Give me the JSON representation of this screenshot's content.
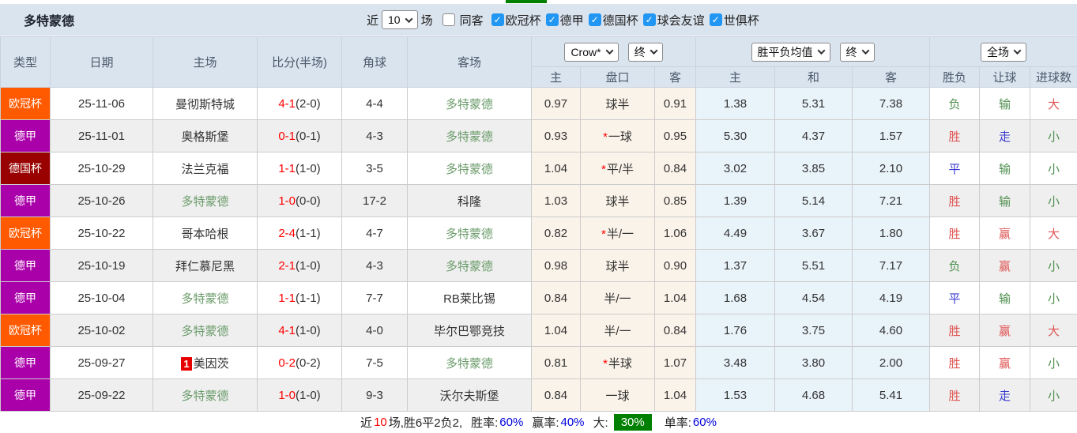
{
  "header": {
    "title": "多特蒙德"
  },
  "filters": {
    "near_label": "近",
    "recent_value": "10",
    "matches_label": "场",
    "same_away_label": "同客",
    "same_away_checked": false,
    "leagues": [
      {
        "label": "欧冠杯",
        "checked": true
      },
      {
        "label": "德甲",
        "checked": true
      },
      {
        "label": "德国杯",
        "checked": true
      },
      {
        "label": "球会友谊",
        "checked": true
      },
      {
        "label": "世俱杯",
        "checked": true
      }
    ]
  },
  "selects": {
    "odds_company": "Crow*",
    "odds_time": "终",
    "avg_type": "胜平负均值",
    "avg_time": "终",
    "period": "全场"
  },
  "table": {
    "headers": {
      "type": "类型",
      "date": "日期",
      "home": "主场",
      "score": "比分(半场)",
      "corners": "角球",
      "away": "客场",
      "odds_home": "主",
      "handicap": "盘口",
      "odds_away": "客",
      "avg_home": "主",
      "avg_draw": "和",
      "avg_away": "客",
      "result_wdl": "胜负",
      "result_handicap": "让球",
      "result_goals": "进球数"
    },
    "league_colors": {
      "欧冠杯": "#ff5a00",
      "德甲": "#aa00aa",
      "德国杯": "#990000"
    },
    "rows": [
      {
        "league": "欧冠杯",
        "date": "25-11-06",
        "home": "曼彻斯特城",
        "home_is_team": false,
        "home_rank": "",
        "score": "4-1",
        "half": "(2-0)",
        "corners": "4-4",
        "away": "多特蒙德",
        "away_is_team": true,
        "odds_home": "0.97",
        "handicap": "球半",
        "handicap_star": false,
        "odds_away": "0.91",
        "avg_home": "1.38",
        "avg_draw": "5.31",
        "avg_away": "7.38",
        "res_wdl": "负",
        "res_wdl_c": "green",
        "res_let": "输",
        "res_let_c": "green",
        "res_goal": "大",
        "res_goal_c": "red"
      },
      {
        "league": "德甲",
        "date": "25-11-01",
        "home": "奥格斯堡",
        "home_is_team": false,
        "home_rank": "",
        "score": "0-1",
        "half": "(0-1)",
        "corners": "4-3",
        "away": "多特蒙德",
        "away_is_team": true,
        "odds_home": "0.93",
        "handicap": "一球",
        "handicap_star": true,
        "odds_away": "0.95",
        "avg_home": "5.30",
        "avg_draw": "4.37",
        "avg_away": "1.57",
        "res_wdl": "胜",
        "res_wdl_c": "red",
        "res_let": "走",
        "res_let_c": "blue",
        "res_goal": "小",
        "res_goal_c": "green"
      },
      {
        "league": "德国杯",
        "date": "25-10-29",
        "home": "法兰克福",
        "home_is_team": false,
        "home_rank": "",
        "score": "1-1",
        "half": "(1-0)",
        "corners": "3-5",
        "away": "多特蒙德",
        "away_is_team": true,
        "odds_home": "1.04",
        "handicap": "平/半",
        "handicap_star": true,
        "odds_away": "0.84",
        "avg_home": "3.02",
        "avg_draw": "3.85",
        "avg_away": "2.10",
        "res_wdl": "平",
        "res_wdl_c": "blue",
        "res_let": "输",
        "res_let_c": "green",
        "res_goal": "小",
        "res_goal_c": "green"
      },
      {
        "league": "德甲",
        "date": "25-10-26",
        "home": "多特蒙德",
        "home_is_team": true,
        "home_rank": "",
        "score": "1-0",
        "half": "(0-0)",
        "corners": "17-2",
        "away": "科隆",
        "away_is_team": false,
        "odds_home": "1.03",
        "handicap": "球半",
        "handicap_star": false,
        "odds_away": "0.85",
        "avg_home": "1.39",
        "avg_draw": "5.14",
        "avg_away": "7.21",
        "res_wdl": "胜",
        "res_wdl_c": "red",
        "res_let": "输",
        "res_let_c": "green",
        "res_goal": "小",
        "res_goal_c": "green"
      },
      {
        "league": "欧冠杯",
        "date": "25-10-22",
        "home": "哥本哈根",
        "home_is_team": false,
        "home_rank": "",
        "score": "2-4",
        "half": "(1-1)",
        "corners": "4-7",
        "away": "多特蒙德",
        "away_is_team": true,
        "odds_home": "0.82",
        "handicap": "半/一",
        "handicap_star": true,
        "odds_away": "1.06",
        "avg_home": "4.49",
        "avg_draw": "3.67",
        "avg_away": "1.80",
        "res_wdl": "胜",
        "res_wdl_c": "red",
        "res_let": "赢",
        "res_let_c": "red",
        "res_goal": "大",
        "res_goal_c": "red"
      },
      {
        "league": "德甲",
        "date": "25-10-19",
        "home": "拜仁慕尼黑",
        "home_is_team": false,
        "home_rank": "",
        "score": "2-1",
        "half": "(1-0)",
        "corners": "4-3",
        "away": "多特蒙德",
        "away_is_team": true,
        "odds_home": "0.98",
        "handicap": "球半",
        "handicap_star": false,
        "odds_away": "0.90",
        "avg_home": "1.37",
        "avg_draw": "5.51",
        "avg_away": "7.17",
        "res_wdl": "负",
        "res_wdl_c": "green",
        "res_let": "赢",
        "res_let_c": "red",
        "res_goal": "小",
        "res_goal_c": "green"
      },
      {
        "league": "德甲",
        "date": "25-10-04",
        "home": "多特蒙德",
        "home_is_team": true,
        "home_rank": "",
        "score": "1-1",
        "half": "(1-1)",
        "corners": "7-7",
        "away": "RB莱比锡",
        "away_is_team": false,
        "odds_home": "0.84",
        "handicap": "半/一",
        "handicap_star": false,
        "odds_away": "1.04",
        "avg_home": "1.68",
        "avg_draw": "4.54",
        "avg_away": "4.19",
        "res_wdl": "平",
        "res_wdl_c": "blue",
        "res_let": "输",
        "res_let_c": "green",
        "res_goal": "小",
        "res_goal_c": "green"
      },
      {
        "league": "欧冠杯",
        "date": "25-10-02",
        "home": "多特蒙德",
        "home_is_team": true,
        "home_rank": "",
        "score": "4-1",
        "half": "(1-0)",
        "corners": "4-0",
        "away": "毕尔巴鄂竞技",
        "away_is_team": false,
        "odds_home": "1.04",
        "handicap": "半/一",
        "handicap_star": false,
        "odds_away": "0.84",
        "avg_home": "1.76",
        "avg_draw": "3.75",
        "avg_away": "4.60",
        "res_wdl": "胜",
        "res_wdl_c": "red",
        "res_let": "赢",
        "res_let_c": "red",
        "res_goal": "大",
        "res_goal_c": "red"
      },
      {
        "league": "德甲",
        "date": "25-09-27",
        "home": "美因茨",
        "home_is_team": false,
        "home_rank": "1",
        "score": "0-2",
        "half": "(0-2)",
        "corners": "7-5",
        "away": "多特蒙德",
        "away_is_team": true,
        "odds_home": "0.81",
        "handicap": "半球",
        "handicap_star": true,
        "odds_away": "1.07",
        "avg_home": "3.48",
        "avg_draw": "3.80",
        "avg_away": "2.00",
        "res_wdl": "胜",
        "res_wdl_c": "red",
        "res_let": "赢",
        "res_let_c": "red",
        "res_goal": "小",
        "res_goal_c": "green"
      },
      {
        "league": "德甲",
        "date": "25-09-22",
        "home": "多特蒙德",
        "home_is_team": true,
        "home_rank": "",
        "score": "1-0",
        "half": "(1-0)",
        "corners": "9-3",
        "away": "沃尔夫斯堡",
        "away_is_team": false,
        "odds_home": "0.84",
        "handicap": "一球",
        "handicap_star": false,
        "odds_away": "1.04",
        "avg_home": "1.53",
        "avg_draw": "4.68",
        "avg_away": "5.41",
        "res_wdl": "胜",
        "res_wdl_c": "red",
        "res_let": "走",
        "res_let_c": "blue",
        "res_goal": "小",
        "res_goal_c": "green"
      }
    ]
  },
  "footer": {
    "near_label": "近",
    "count": "10",
    "summary": "场,胜6平2负2,",
    "win_rate_label": "胜率:",
    "win_rate": "60%",
    "handicap_rate_label": "赢率:",
    "handicap_rate": "40%",
    "big_label": "大:",
    "big_rate": "30%",
    "single_label": "单率:",
    "single_rate": "60%"
  },
  "colors": {
    "header_bg": "#dae4ef",
    "zebra_bg": "#efefef",
    "odds_col_bg": "#faf3e9",
    "avg_col_bg": "#e9f3fa",
    "team_green": "#6b9c6b",
    "score_red": "#ff0000",
    "result_red": "#e05555",
    "result_green": "#4e8f4e",
    "result_blue": "#3939cf",
    "checkbox_blue": "#2196f3",
    "footer_green": "#008000",
    "footer_blue": "#0000dd",
    "rank_badge_red": "#e60000"
  }
}
